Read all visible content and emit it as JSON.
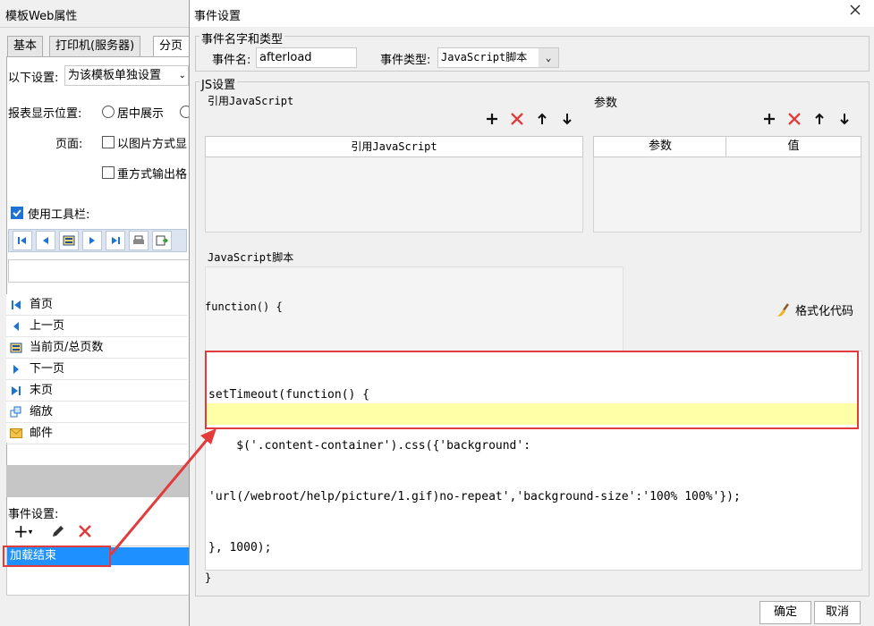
{
  "left_panel": {
    "title": "模板Web属性",
    "tabs": [
      "基本",
      "打印机(服务器)",
      "分页"
    ],
    "setting_label": "以下设置:",
    "setting_value": "为该模板单独设置",
    "display_position_label": "报表显示位置:",
    "display_position_option": "居中展示",
    "page_label": "页面:",
    "page_option_image": "以图片方式显",
    "page_option_reoutput": "重方式输出格",
    "use_toolbar_label": "使用工具栏:",
    "nav_items": [
      "首页",
      "上一页",
      "当前页/总页数",
      "下一页",
      "末页",
      "缩放",
      "邮件"
    ],
    "event_settings_label": "事件设置:",
    "event_list": [
      "加载结束"
    ]
  },
  "dialog": {
    "title": "事件设置",
    "event_group_title": "事件名字和类型",
    "event_name_label": "事件名:",
    "event_name_value": "afterload",
    "event_type_label": "事件类型:",
    "event_type_value": "JavaScript脚本",
    "js_group_title": "JS设置",
    "ref_js_title": "引用JavaScript",
    "ref_js_column": "引用JavaScript",
    "params_title": "参数",
    "params_columns": [
      "参数",
      "值"
    ],
    "script_title": "JavaScript脚本",
    "code_header": "function() {",
    "format_code_label": "格式化代码",
    "code_lines": [
      "setTimeout(function() {",
      "    $('.content-container').css({'background':",
      "'url(/webroot/help/picture/1.gif)no-repeat','background-size':'100% 100%'});",
      "}, 1000);"
    ],
    "code_footer": "}",
    "ok_label": "确定",
    "cancel_label": "取消"
  },
  "colors": {
    "highlight_red": "#e23b3b",
    "selection_blue": "#1e90ff",
    "current_line_yellow": "#ffffa8"
  }
}
